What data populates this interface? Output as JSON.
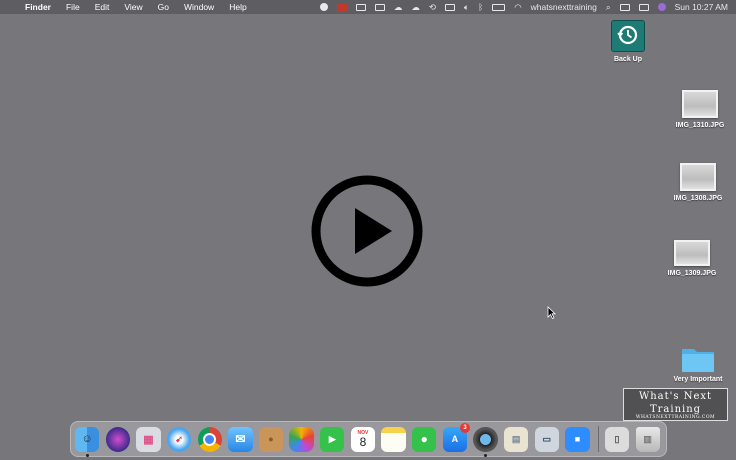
{
  "menubar": {
    "apple_glyph": "",
    "app_name": "Finder",
    "menus": [
      "File",
      "Edit",
      "View",
      "Go",
      "Window",
      "Help"
    ],
    "user_name": "whatsnexttraining",
    "clock": "Sun 10:27 AM"
  },
  "desktop": {
    "backup": {
      "label": "Back Up"
    },
    "files": [
      {
        "label": "IMG_1310.JPG"
      },
      {
        "label": "IMG_1308.JPG"
      },
      {
        "label": "IMG_1309.JPG"
      }
    ],
    "folder": {
      "label": "Very Important"
    }
  },
  "watermark": {
    "line1": "What's Next",
    "line2": "Training",
    "line3": "WHATSNEXTTRAINING.COM"
  },
  "dock": {
    "calendar_month": "NOV",
    "calendar_day": "8",
    "app_store_badge": "3"
  },
  "colors": {
    "desktop": "#76767b",
    "menubar": "#5d5d62",
    "folder": "#6ec6f5",
    "backup": "#1e7a74"
  }
}
